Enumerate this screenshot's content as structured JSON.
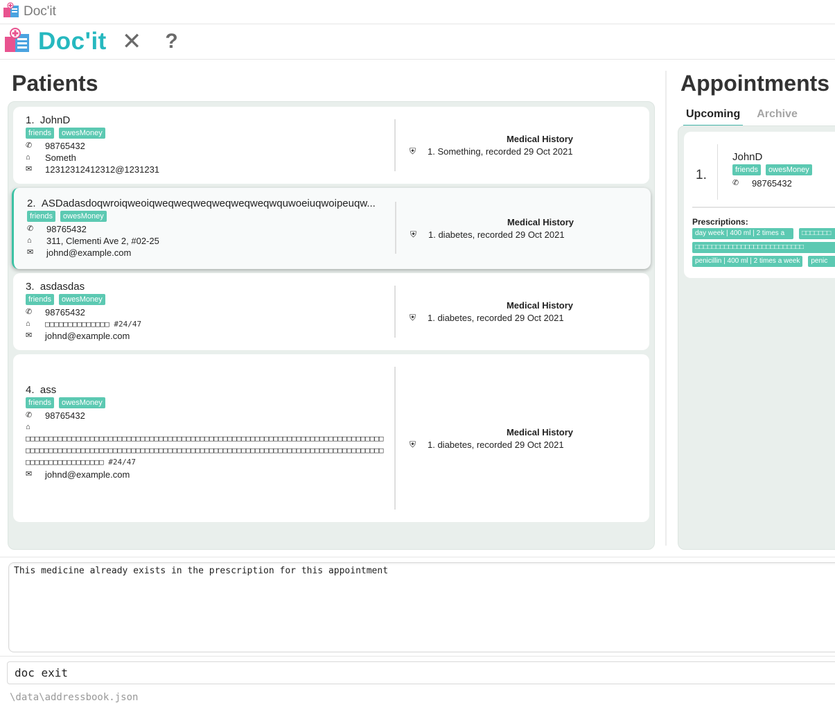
{
  "window": {
    "title": "Doc'it"
  },
  "menubar": {
    "brand": "Doc'it",
    "close_glyph": "✕",
    "help_glyph": "?"
  },
  "patients": {
    "heading": "Patients",
    "list": [
      {
        "index": "1.",
        "name": "JohnD",
        "tags": [
          "friends",
          "owesMoney"
        ],
        "phone": "98765432",
        "address": "Someth",
        "email": "12312312412312@1231231",
        "history_title": "Medical History",
        "history": [
          "1. Something, recorded 29 Oct 2021"
        ]
      },
      {
        "index": "2.",
        "name": "ASDadasdoqwroiqweoiqweqweqweqweqweqweqwquwoeiuqwoipeuqw...",
        "tags": [
          "friends",
          "owesMoney"
        ],
        "phone": "98765432",
        "address": "311, Clementi Ave 2, #02-25",
        "email": "johnd@example.com",
        "history_title": "Medical History",
        "history": [
          "1. diabetes, recorded 29 Oct 2021"
        ]
      },
      {
        "index": "3.",
        "name": "asdasdas",
        "tags": [
          "friends",
          "owesMoney"
        ],
        "phone": "98765432",
        "address": "□□□□□□□□□□□□□□ #24/47",
        "email": "johnd@example.com",
        "history_title": "Medical History",
        "history": [
          "1. diabetes, recorded 29 Oct 2021"
        ]
      },
      {
        "index": "4.",
        "name": "ass",
        "tags": [
          "friends",
          "owesMoney"
        ],
        "phone": "98765432",
        "address": "□□□□□□□□□□□□□□□□□□□□□□□□□□□□□□□□□□□□□□□□□□□□□□□□□□□□□□□□□□□□□□□□□□□□□□□□□□□□□□□□□□□□□□□□□□□□□□□□□□□□□□□□□□□□□□□□□□□□□□□□□□□□□□□□□□□□□□□□□□□□□□□□□□□□□□□□□□□□□□□□□□□□□□□□□□□□□ #24/47",
        "email": "johnd@example.com",
        "history_title": "Medical History",
        "history": [
          "1. diabetes, recorded 29 Oct 2021"
        ]
      }
    ]
  },
  "appointments": {
    "heading": "Appointments",
    "tabs": [
      {
        "label": "Upcoming",
        "active": true
      },
      {
        "label": "Archive",
        "active": false
      }
    ],
    "list": [
      {
        "index": "1.",
        "name": "JohnD",
        "tags": [
          "friends",
          "owesMoney"
        ],
        "phone": "98765432",
        "prescriptions_title": "Prescriptions:",
        "prescriptions": [
          "day week | 400 ml | 2 times a",
          "□□□□□□□",
          "□□□□□□□□□□□□□□□□□□□□□□□□□□",
          "penicillin | 400 ml | 2 times a week",
          "penic"
        ]
      }
    ]
  },
  "result": {
    "text": "This medicine already exists in the prescription for this appointment"
  },
  "command": {
    "value": "doc exit"
  },
  "status": {
    "path": "\\data\\addressbook.json"
  }
}
